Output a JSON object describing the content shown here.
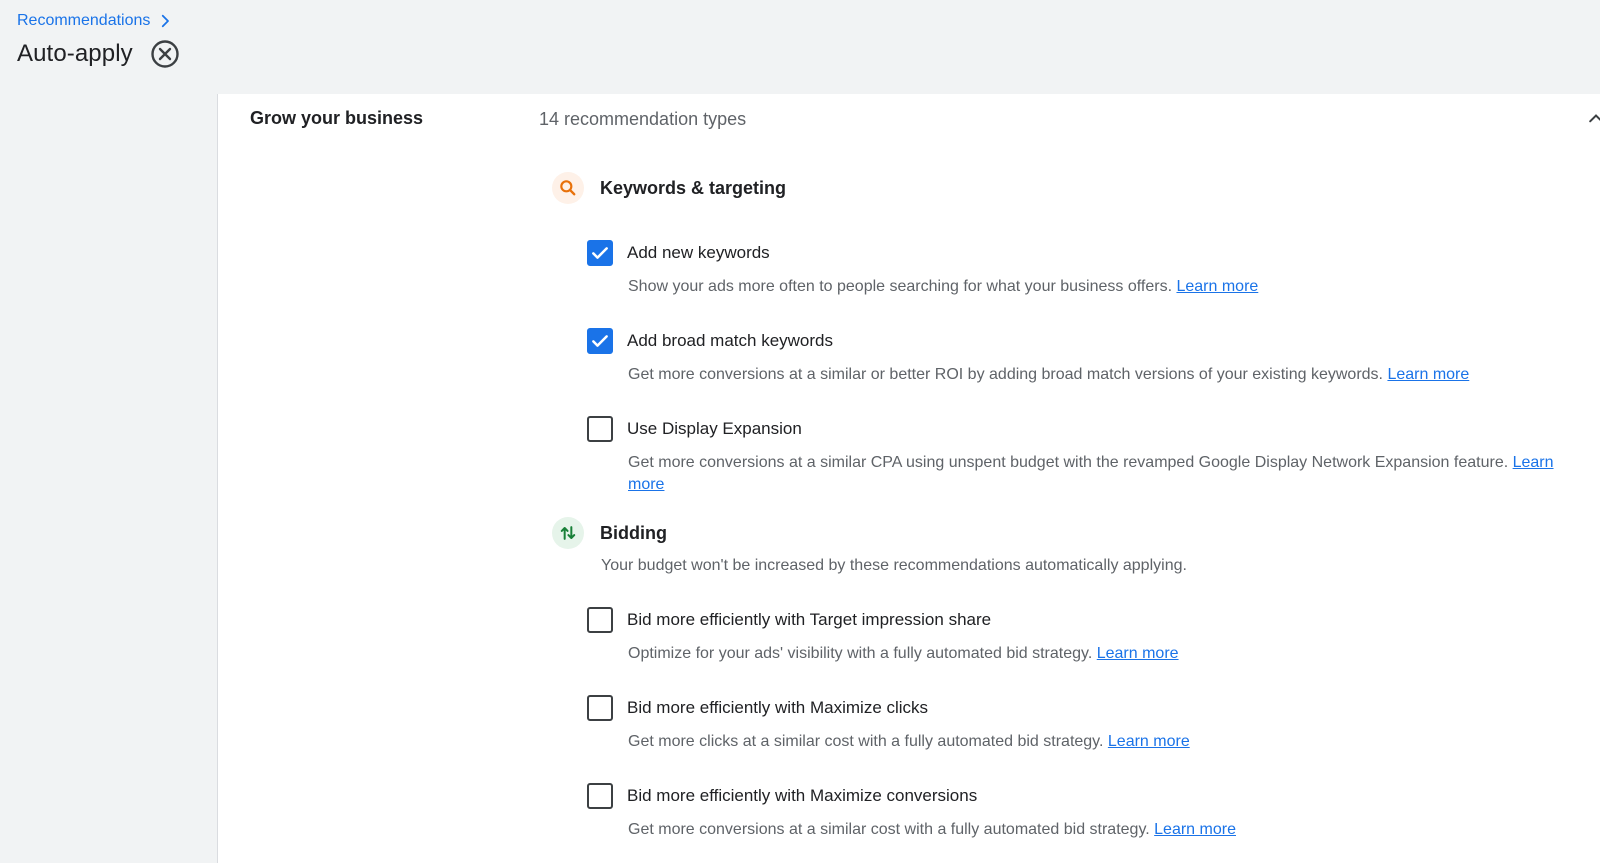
{
  "breadcrumb": {
    "parent": "Recommendations"
  },
  "page": {
    "title": "Auto-apply"
  },
  "section": {
    "title": "Grow your business",
    "count": "14 recommendation types"
  },
  "groups": [
    {
      "title": "Keywords & targeting",
      "icon": "search-icon",
      "color": "#e8710a",
      "items": [
        {
          "label": "Add new keywords",
          "checked": true,
          "desc": "Show your ads more often to people searching for what your business offers.",
          "link": "Learn more"
        },
        {
          "label": "Add broad match keywords",
          "checked": true,
          "desc": "Get more conversions at a similar or better ROI by adding broad match versions of your existing keywords.",
          "link": "Learn more"
        },
        {
          "label": "Use Display Expansion",
          "checked": false,
          "desc": "Get more conversions at a similar CPA using unspent budget with the revamped Google Display Network Expansion feature.",
          "link": "Learn more"
        }
      ]
    },
    {
      "title": "Bidding",
      "icon": "bidding-arrows-icon",
      "color": "#188038",
      "note": "Your budget won't be increased by these recommendations automatically applying.",
      "items": [
        {
          "label": "Bid more efficiently with Target impression share",
          "checked": false,
          "desc": "Optimize for your ads' visibility with a fully automated bid strategy.",
          "link": "Learn more"
        },
        {
          "label": "Bid more efficiently with Maximize clicks",
          "checked": false,
          "desc": "Get more clicks at a similar cost with a fully automated bid strategy.",
          "link": "Learn more"
        },
        {
          "label": "Bid more efficiently with Maximize conversions",
          "checked": false,
          "desc": "Get more conversions at a similar cost with a fully automated bid strategy.",
          "link": "Learn more"
        }
      ]
    }
  ],
  "colors": {
    "accent": "#1a73e8",
    "text": "#202124",
    "muted": "#5f6368"
  }
}
